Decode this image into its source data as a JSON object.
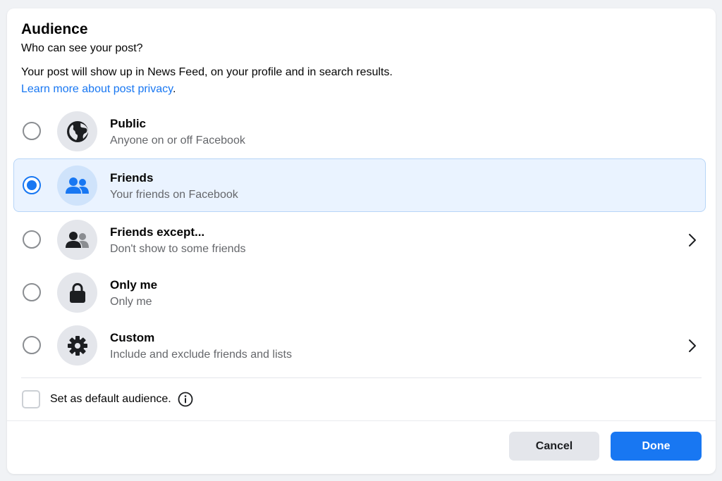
{
  "dialog": {
    "title": "Audience",
    "subtitle": "Who can see your post?",
    "description": "Your post will show up in News Feed, on your profile and in search results.",
    "learn_more_link": "Learn more about post privacy",
    "learn_more_suffix": "."
  },
  "options": [
    {
      "title": "Public",
      "subtitle": "Anyone on or off Facebook",
      "icon": "globe-icon",
      "selected": false,
      "has_chevron": false
    },
    {
      "title": "Friends",
      "subtitle": "Your friends on Facebook",
      "icon": "friends-icon",
      "selected": true,
      "has_chevron": false
    },
    {
      "title": "Friends except...",
      "subtitle": "Don't show to some friends",
      "icon": "friends-except-icon",
      "selected": false,
      "has_chevron": true
    },
    {
      "title": "Only me",
      "subtitle": "Only me",
      "icon": "lock-icon",
      "selected": false,
      "has_chevron": false
    },
    {
      "title": "Custom",
      "subtitle": "Include and exclude friends and lists",
      "icon": "gear-icon",
      "selected": false,
      "has_chevron": true
    }
  ],
  "default_audience": {
    "label": "Set as default audience.",
    "checked": false,
    "info_icon": "info-icon"
  },
  "buttons": {
    "cancel": "Cancel",
    "done": "Done"
  },
  "colors": {
    "accent": "#1877f2",
    "selected_bg": "#eaf3ff",
    "icon_bg": "#e4e6eb",
    "secondary_text": "#65676b"
  }
}
